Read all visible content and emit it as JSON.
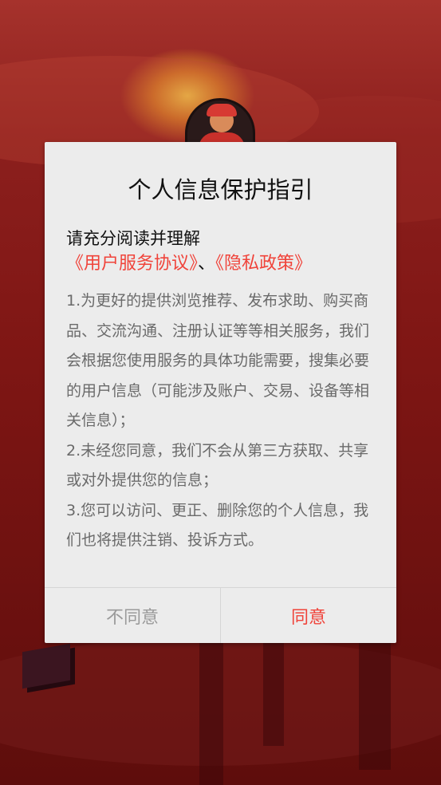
{
  "dialog": {
    "title": "个人信息保护指引",
    "intro": "请充分阅读并理解",
    "user_agreement_link": "《用户服务协议》",
    "separator": "、",
    "privacy_policy_link": "《隐私政策》",
    "paragraphs": [
      "1.为更好的提供浏览推荐、发布求助、购买商品、交流沟通、注册认证等等相关服务，我们会根据您使用服务的具体功能需要，搜集必要的用户信息（可能涉及账户、交易、设备等相关信息）；",
      "2.未经您同意，我们不会从第三方获取、共享或对外提供您的信息；",
      "3.您可以访问、更正、删除您的个人信息，我们也将提供注销、投诉方式。"
    ],
    "disagree_label": "不同意",
    "agree_label": "同意"
  },
  "colors": {
    "accent": "#f0433a",
    "dialog_bg": "#ececec",
    "body_text": "#6a6a6a",
    "disabled_text": "#9a9a9a"
  }
}
